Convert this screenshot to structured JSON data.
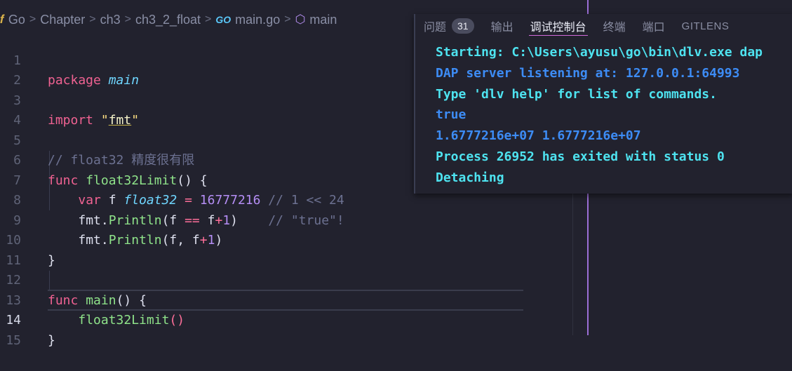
{
  "breadcrumb": {
    "items": [
      "Go",
      "Chapter",
      "ch3",
      "ch3_2_float"
    ],
    "go_logo": "GO",
    "file": "main.go",
    "symbol": "main",
    "separator": ">"
  },
  "editor": {
    "active_line": 14,
    "lines": [
      {
        "n": "1"
      },
      {
        "n": "2"
      },
      {
        "n": "3"
      },
      {
        "n": "4"
      },
      {
        "n": "5"
      },
      {
        "n": "6"
      },
      {
        "n": "7"
      },
      {
        "n": "8"
      },
      {
        "n": "9"
      },
      {
        "n": "10"
      },
      {
        "n": "11"
      },
      {
        "n": "12"
      },
      {
        "n": "13"
      },
      {
        "n": "14"
      },
      {
        "n": "15"
      }
    ],
    "tokens": {
      "l1": [
        "package",
        "main"
      ],
      "l3": [
        "import",
        "\"",
        "fmt",
        "\""
      ],
      "l5": [
        "// float32 精度很有限"
      ],
      "l6": [
        "func",
        "float32Limit",
        "() {"
      ],
      "l7": [
        "var",
        " f ",
        "float32",
        " = ",
        "16777216",
        " // 1 << 24"
      ],
      "l8": [
        "fmt.",
        "Println",
        "(f ",
        "==",
        " f",
        "+",
        "1",
        ")",
        "    // \"true\"!"
      ],
      "l9": [
        "fmt.",
        "Println",
        "(f, f",
        "+",
        "1",
        ")"
      ],
      "l10": [
        "}"
      ],
      "l12": [
        "func",
        "main",
        "() {"
      ],
      "l13": [
        "float32Limit",
        "()"
      ],
      "l14": [
        "}"
      ]
    }
  },
  "panel": {
    "tabs": [
      {
        "label": "问题",
        "badge": "31"
      },
      {
        "label": "输出"
      },
      {
        "label": "调试控制台",
        "active": true
      },
      {
        "label": "终端"
      },
      {
        "label": "端口"
      },
      {
        "label": "GITLENS"
      }
    ],
    "console": [
      {
        "text": "Starting: C:\\Users\\ayusu\\go\\bin\\dlv.exe dap",
        "color": "#4ee3f0"
      },
      {
        "text": "DAP server listening at: 127.0.0.1:64993",
        "color": "#3d8cf5"
      },
      {
        "text": "Type 'dlv help' for list of commands.",
        "color": "#4ee3f0"
      },
      {
        "text": "true",
        "color": "#3d8cf5"
      },
      {
        "text": "1.6777216e+07 1.6777216e+07",
        "color": "#3d8cf5"
      },
      {
        "text": "Process 26952 has exited with status 0",
        "color": "#4ee3f0"
      },
      {
        "text": "Detaching",
        "color": "#4ee3f0"
      }
    ]
  },
  "colors": {
    "background": "#22222e",
    "keyword": "#f06292",
    "function": "#8fe38a",
    "number": "#b58ef5",
    "type": "#6fd6ff",
    "comment": "#6c7191",
    "console_cyan": "#4ee3f0",
    "console_blue": "#3d8cf5",
    "cursor_column": "#9b6fd6"
  }
}
